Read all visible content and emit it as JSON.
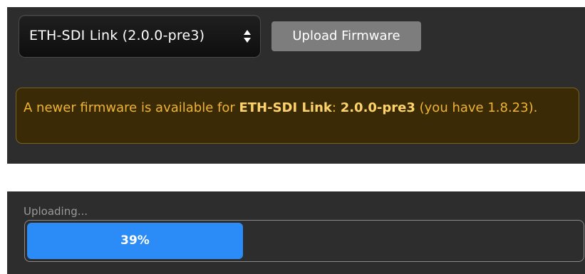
{
  "firmware_select": {
    "selected": "ETH-SDI Link (2.0.0-pre3)",
    "arrows_icon": "up-down-arrows-icon"
  },
  "upload_button": {
    "label": "Upload Firmware"
  },
  "alert": {
    "prefix": "A newer firmware is available for ",
    "device": "ETH-SDI Link",
    "separator": ": ",
    "version": "2.0.0-pre3",
    "suffix": " (you have 1.8.23).",
    "text_color": "#f0b432",
    "background_color": "#3a2b06"
  },
  "upload_progress": {
    "label": "Uploading...",
    "percent_text": "39%",
    "fraction": 0.39,
    "bar_color": "#2c8cf7"
  }
}
